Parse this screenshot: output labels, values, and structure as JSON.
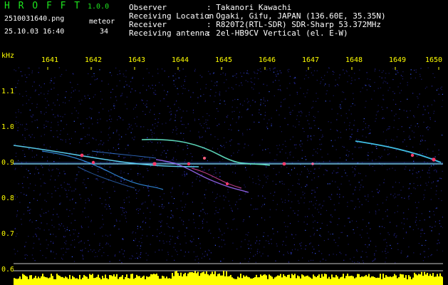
{
  "app": {
    "name": "H R O F F T",
    "version": "1.0.0"
  },
  "file": {
    "name": "2510031640.png",
    "datetime": "25.10.03 16:40"
  },
  "meteor": {
    "label": "meteor",
    "count": "34"
  },
  "info": [
    {
      "key": "Observer",
      "value": ": Takanori Kawachi"
    },
    {
      "key": "Receiving Location",
      "value": ": Ogaki, Gifu, JAPAN (136.60E, 35.35N)"
    },
    {
      "key": "Receiver",
      "value": ": R820T2(RTL-SDR) SDR-Sharp 53.372MHz"
    },
    {
      "key": "Receiving antenna",
      "value": ": 2el-HB9CV Vertical (el. E-W)"
    }
  ],
  "axes": {
    "y_unit": "kHz",
    "y_ticks": [
      "1.1",
      "1.0",
      "0.9",
      "0.8",
      "0.7",
      "0.6"
    ],
    "x_ticks": [
      "1641",
      "1642",
      "1643",
      "1644",
      "1645",
      "1646",
      "1647",
      "1648",
      "1649",
      "1650"
    ]
  },
  "colors": {
    "header_text": "#1ee51e",
    "info_text": "#ffffff",
    "axis_label": "#ffff00",
    "background": "#000000",
    "noise": "#1a1a8c",
    "signal_line": "#6fd3ff",
    "hot": "#ff3a6a",
    "power_bar": "#ffff00",
    "power_base": "#22ccff"
  }
}
